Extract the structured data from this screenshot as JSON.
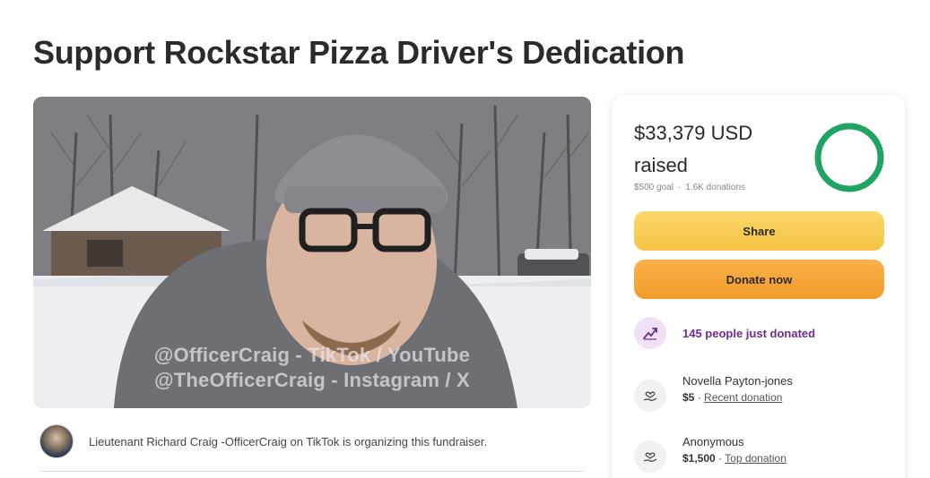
{
  "page": {
    "title": "Support Rockstar Pizza Driver's Dedication"
  },
  "hero": {
    "caption_line1": "@OfficerCraig - TikTok / YouTube",
    "caption_line2": "@TheOfficerCraig - Instagram / X"
  },
  "organizer": {
    "text": "Lieutenant Richard Craig -OfficerCraig on TikTok is organizing this fundraiser."
  },
  "donation_card": {
    "amount": "$33,379 USD",
    "raised_label": "raised",
    "goal": "$500 goal",
    "donations_count": "1.6K donations",
    "separator": "·",
    "progress_fraction": 1.0,
    "share_label": "Share",
    "donate_label": "Donate now",
    "just_donated": "145 people just donated",
    "donors": [
      {
        "name": "Novella Payton-jones",
        "amount": "$5",
        "sep": " · ",
        "tag": "Recent donation"
      },
      {
        "name": "Anonymous",
        "amount": "$1,500",
        "sep": " · ",
        "tag": "Top donation"
      }
    ]
  },
  "colors": {
    "progress_ring": "#1fa463",
    "share_button": "#f6c343",
    "donate_button": "#f39b2c",
    "accent_purple": "#6f2c91"
  },
  "icons": {
    "trend": "trending-up-icon",
    "donor": "hand-heart-icon",
    "avatar": "avatar"
  }
}
